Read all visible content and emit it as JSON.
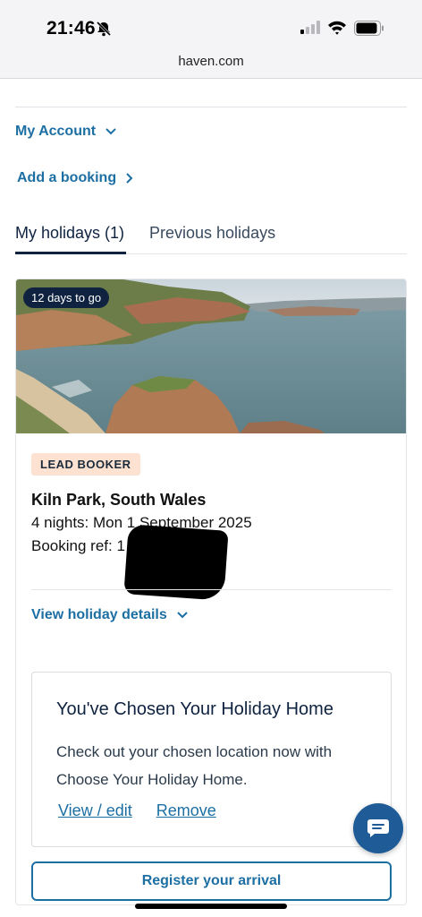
{
  "status_bar": {
    "time": "21:46"
  },
  "browser": {
    "url": "haven.com"
  },
  "nav": {
    "my_account": "My Account",
    "add_booking": "Add a booking"
  },
  "tabs": [
    {
      "label": "My holidays (1)",
      "active": true
    },
    {
      "label": "Previous holidays",
      "active": false
    }
  ],
  "booking": {
    "countdown": "12 days to go",
    "badge": "LEAD BOOKER",
    "park": "Kiln Park, South Wales",
    "nights": "4 nights: Mon 1 September 2025",
    "booking_ref": "Booking ref: 1",
    "view_details": "View holiday details"
  },
  "holiday_home": {
    "title": "You've Chosen Your Holiday Home",
    "text": "Check out your chosen location now with Choose Your Holiday Home.",
    "view_edit": "View / edit",
    "remove": "Remove"
  },
  "actions": {
    "register": "Register your arrival"
  },
  "colors": {
    "accent": "#1d6fa3",
    "navy": "#0f2340",
    "badge_bg": "#fde2d1"
  }
}
